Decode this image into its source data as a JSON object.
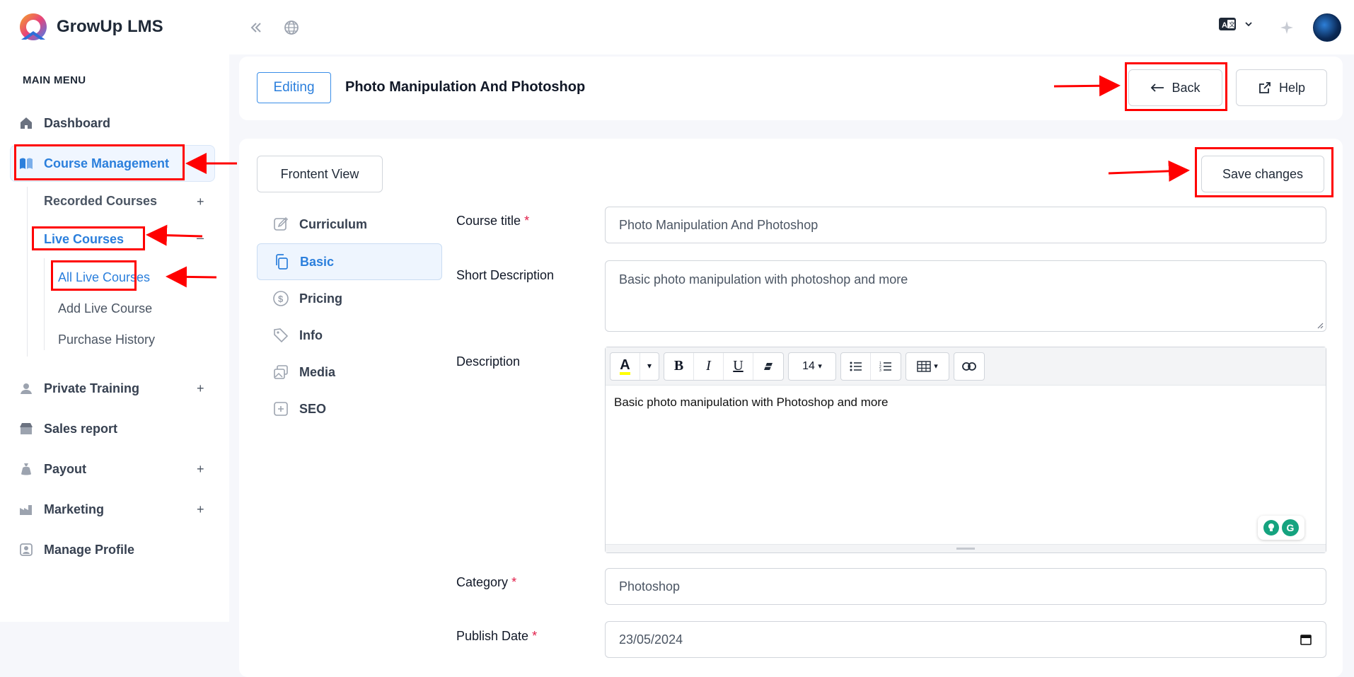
{
  "app": {
    "name": "GrowUp LMS"
  },
  "sidebar": {
    "menu_title": "MAIN MENU",
    "items": [
      {
        "label": "Dashboard"
      },
      {
        "label": "Course Management"
      },
      {
        "label": "Private Training",
        "toggle": "+"
      },
      {
        "label": "Sales report"
      },
      {
        "label": "Payout",
        "toggle": "+"
      },
      {
        "label": "Marketing",
        "toggle": "+"
      },
      {
        "label": "Manage Profile"
      }
    ],
    "course_sub": [
      {
        "label": "Recorded Courses",
        "toggle": "+"
      },
      {
        "label": "Live Courses",
        "toggle": "–"
      }
    ],
    "live_sub": [
      {
        "label": "All Live Courses"
      },
      {
        "label": "Add Live Course"
      },
      {
        "label": "Purchase History"
      }
    ]
  },
  "header": {
    "badge": "Editing",
    "title": "Photo Manipulation And Photoshop",
    "back_label": "Back",
    "help_label": "Help"
  },
  "actions": {
    "frontend_view": "Frontent View",
    "save": "Save changes"
  },
  "tabs": [
    {
      "label": "Curriculum"
    },
    {
      "label": "Basic"
    },
    {
      "label": "Pricing"
    },
    {
      "label": "Info"
    },
    {
      "label": "Media"
    },
    {
      "label": "SEO"
    }
  ],
  "form": {
    "course_title": {
      "label": "Course title",
      "required": "*",
      "value": "Photo Manipulation And Photoshop"
    },
    "short_description": {
      "label": "Short Description",
      "value": "Basic photo manipulation with photoshop and more"
    },
    "description": {
      "label": "Description",
      "value": "Basic photo manipulation with Photoshop and more",
      "font_size": "14"
    },
    "category": {
      "label": "Category",
      "required": "*",
      "value": "Photoshop"
    },
    "publish_date": {
      "label": "Publish Date",
      "required": "*",
      "value": "23/05/2024"
    }
  },
  "colors": {
    "accent": "#2b7fdc",
    "annotation": "#ff0000",
    "required": "#e11d48"
  }
}
